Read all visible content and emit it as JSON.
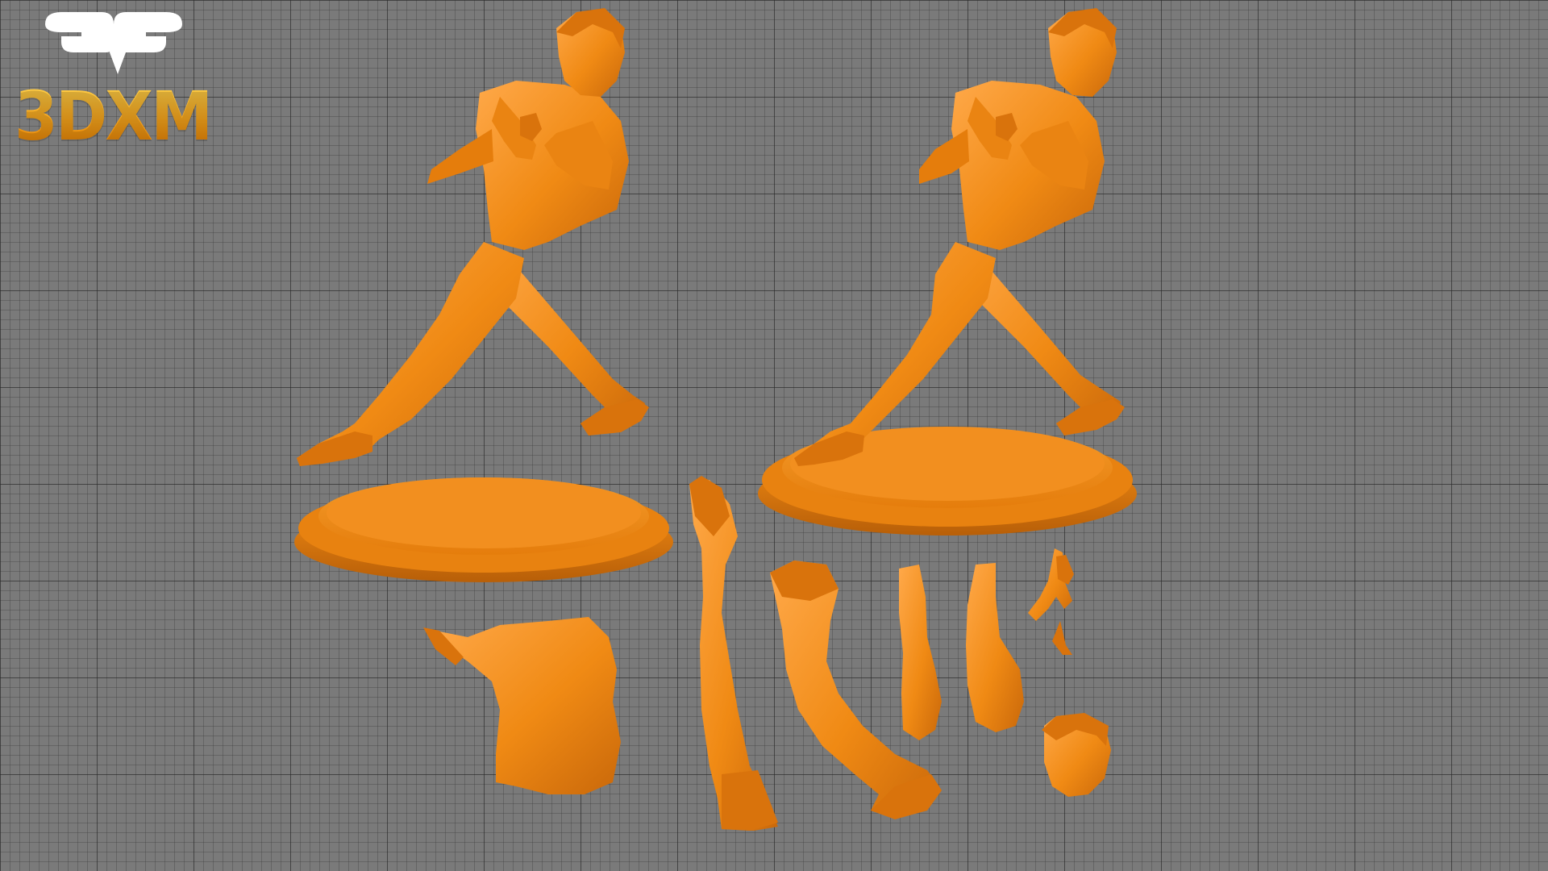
{
  "logo": {
    "text": "3DXM",
    "icon": "3dxm-logo-mark"
  },
  "colors": {
    "model": "#f08a14",
    "model_shadow": "#c9680a",
    "model_highlight": "#ffa94a",
    "grid_background": "#7a7a7a",
    "grid_line": "#3c3c3c",
    "logo_gradient_top": "#ffd34d",
    "logo_gradient_bottom": "#e07a00"
  },
  "scene": {
    "type": "3d-print-model-preview",
    "parts": [
      "figure-on-left",
      "figure-on-right-with-base",
      "oval-base",
      "torso-with-coat-tail",
      "left-leg",
      "right-leg",
      "left-arm",
      "right-arm",
      "hands-with-pistol",
      "head"
    ]
  }
}
